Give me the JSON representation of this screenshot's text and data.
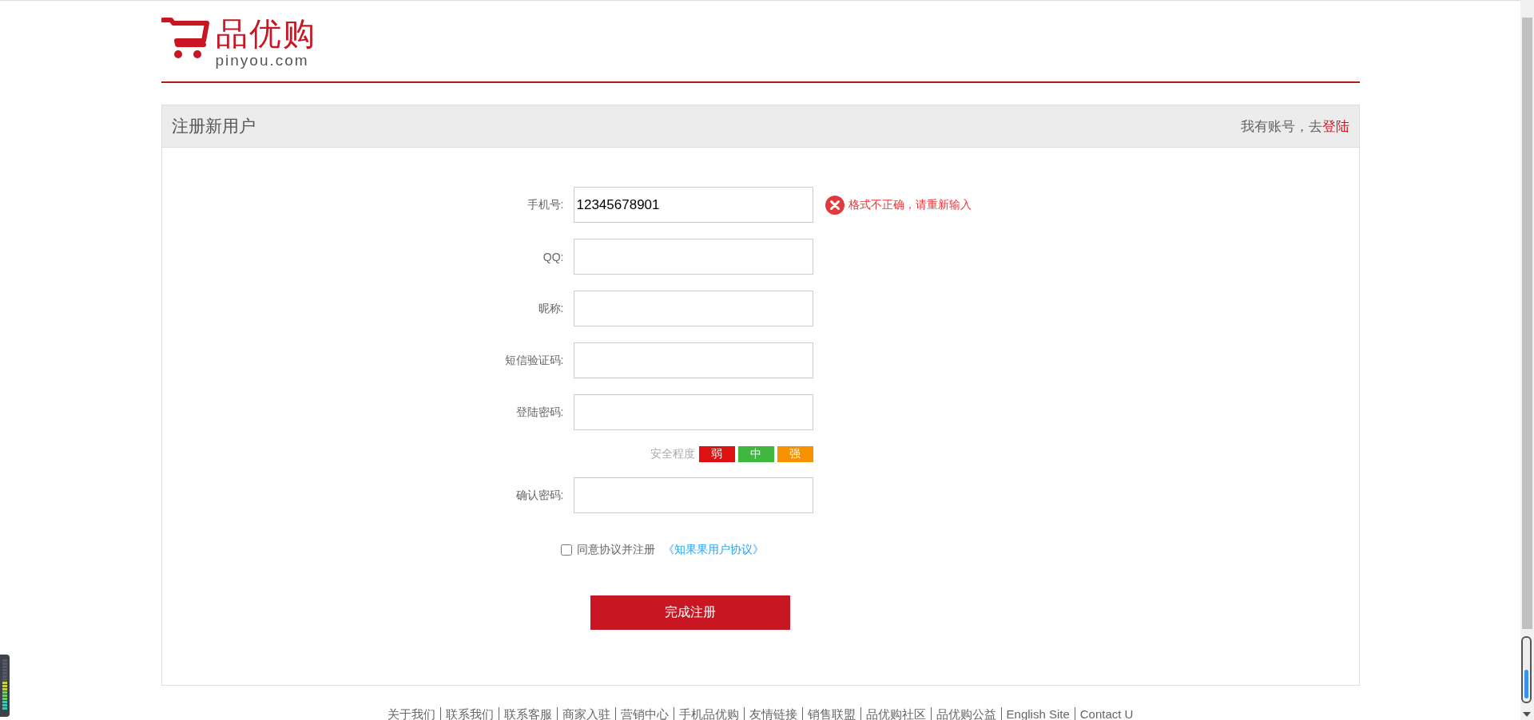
{
  "logo": {
    "name": "品优购",
    "domain": "pinyou.com"
  },
  "register": {
    "title": "注册新用户",
    "login_prompt": "我有账号，去",
    "login_link": "登陆"
  },
  "fields": [
    {
      "label": "手机号:",
      "value": "12345678901",
      "error": "格式不正确，请重新输入"
    },
    {
      "label": "QQ:"
    },
    {
      "label": "昵称:"
    },
    {
      "label": "短信验证码:"
    },
    {
      "label": "登陆密码:",
      "strength": {
        "label": "安全程度",
        "levels": [
          {
            "text": "弱",
            "color": "#dd1111"
          },
          {
            "text": "中",
            "color": "#40b83f"
          },
          {
            "text": "强",
            "color": "#f79100"
          }
        ]
      }
    },
    {
      "label": "确认密码:"
    }
  ],
  "agreement": {
    "text": "同意协议并注册",
    "link": "《知果果用户协议》",
    "checked": false
  },
  "submit": "完成注册",
  "footer_links": [
    "关于我们",
    "联系我们",
    "联系客服",
    "商家入驻",
    "营销中心",
    "手机品优购",
    "友情链接",
    "销售联盟",
    "品优购社区",
    "品优购公益",
    "English Site",
    "Contact U"
  ]
}
